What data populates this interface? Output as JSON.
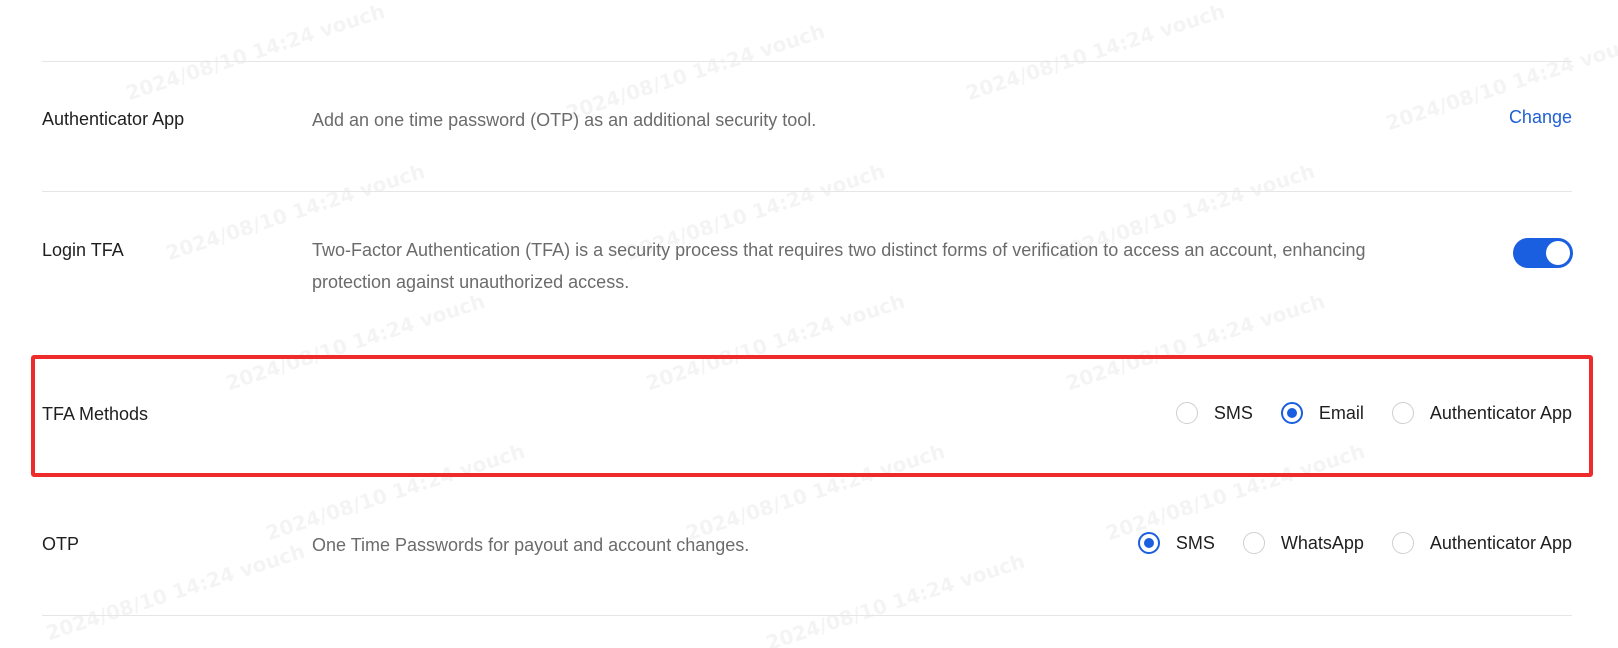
{
  "rows": {
    "authenticator": {
      "label": "Authenticator App",
      "description": "Add an one time password (OTP) as an additional security tool.",
      "action_label": "Change"
    },
    "login_tfa": {
      "label": "Login TFA",
      "description_line1": "Two-Factor Authentication (TFA) is a security process that requires two distinct forms of verification to access an account, enhancing",
      "description_line2": "protection against unauthorized access.",
      "toggle_on": true
    },
    "tfa_methods": {
      "label": "TFA Methods",
      "options": [
        {
          "label": "SMS",
          "checked": false
        },
        {
          "label": "Email",
          "checked": true
        },
        {
          "label": "Authenticator App",
          "checked": false
        }
      ]
    },
    "otp": {
      "label": "OTP",
      "description": "One Time Passwords for payout and account changes.",
      "options": [
        {
          "label": "SMS",
          "checked": true
        },
        {
          "label": "WhatsApp",
          "checked": false
        },
        {
          "label": "Authenticator App",
          "checked": false
        }
      ]
    }
  },
  "colors": {
    "accent": "#1a5fe0",
    "link": "#1f5fd6",
    "highlight_border": "#ee2b2b",
    "muted_text": "#6b6b6b"
  }
}
